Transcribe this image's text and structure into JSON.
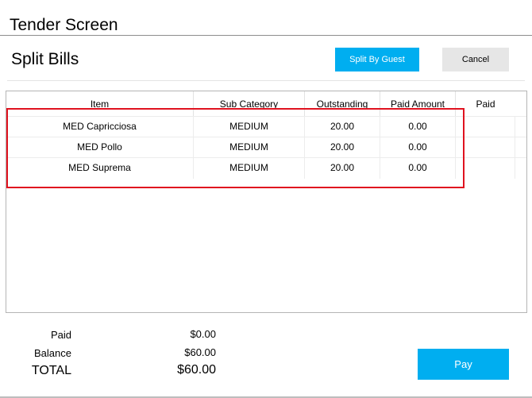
{
  "window": {
    "title": "Tender Screen"
  },
  "page": {
    "title": "Split Bills"
  },
  "actions": {
    "split_by_guest": "Split By Guest",
    "cancel": "Cancel",
    "pay": "Pay"
  },
  "grid": {
    "columns": [
      "Item",
      "Sub Category",
      "Outstanding",
      "Paid Amount",
      "Paid"
    ],
    "rows": [
      {
        "item": "MED Capricciosa",
        "sub_category": "MEDIUM",
        "outstanding": "20.00",
        "paid_amount": "0.00",
        "paid": ""
      },
      {
        "item": "MED Pollo",
        "sub_category": "MEDIUM",
        "outstanding": "20.00",
        "paid_amount": "0.00",
        "paid": ""
      },
      {
        "item": "MED Suprema",
        "sub_category": "MEDIUM",
        "outstanding": "20.00",
        "paid_amount": "0.00",
        "paid": ""
      }
    ]
  },
  "summary": {
    "paid_label": "Paid",
    "paid_value": "$0.00",
    "balance_label": "Balance",
    "balance_value": "$60.00",
    "total_label": "TOTAL",
    "total_value": "$60.00"
  },
  "colors": {
    "accent": "#00aef0",
    "highlight": "#e0121f",
    "cancel_bg": "#e6e6e6"
  }
}
